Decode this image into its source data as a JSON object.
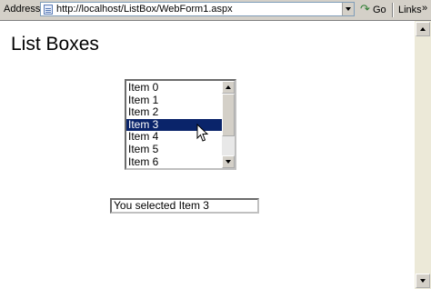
{
  "browser": {
    "address_label": "Address",
    "url": "http://localhost/ListBox/WebForm1.aspx",
    "go_label": "Go",
    "links_label": "Links",
    "links_chevron": "»"
  },
  "page": {
    "title": "List Boxes",
    "listbox": {
      "items": [
        "Item 0",
        "Item 1",
        "Item 2",
        "Item 3",
        "Item 4",
        "Item 5",
        "Item 6"
      ],
      "selected_index": 3
    },
    "result_text": "You selected Item 3"
  },
  "colors": {
    "selection_bg": "#0a246a",
    "selection_fg": "#ffffff",
    "chrome": "#d4d0c8"
  }
}
